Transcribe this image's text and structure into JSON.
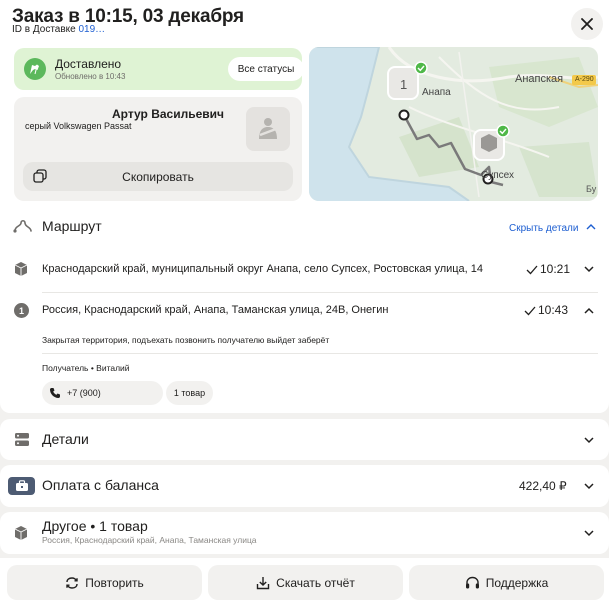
{
  "header": {
    "title": "Заказ в 10:15, 03 декабря",
    "id_prefix": "ID в Доставке ",
    "id_value": "019…"
  },
  "status": {
    "title": "Доставлено",
    "subtitle": "Обновлено в 10:43",
    "all_statuses_label": "Все статусы"
  },
  "driver": {
    "name": "Артур Васильевич",
    "car": "серый Volkswagen Passat",
    "copy_label": "Скопировать"
  },
  "map": {
    "labels": [
      "Анапская",
      "Анапа",
      "Супсех",
      "А-290",
      "Бу"
    ],
    "point_number": "1"
  },
  "route": {
    "title": "Маршрут",
    "hide_details": "Скрыть детали",
    "stops": [
      {
        "address": "Краснодарский край, муниципальный округ Анапа, село Супсех, Ростовская улица, 14",
        "time": "10:21"
      },
      {
        "marker": "1",
        "address": "Россия, Краснодарский край, Анапа, Таманская улица, 24В, Онегин",
        "time": "10:43",
        "comment": "Закрытая территория, подъехать позвонить получателю выйдет заберёт",
        "recipient": "Получатель • Виталий",
        "phone": "+7 (900)",
        "items": "1 товар"
      }
    ]
  },
  "details": {
    "title": "Детали"
  },
  "payment": {
    "title": "Оплата с баланса",
    "amount": "422,40 ₽"
  },
  "other": {
    "title": "Другое • 1 товар",
    "subtitle": "Россия, Краснодарский край, Анапа, Таманская улица"
  },
  "actions": {
    "repeat": "Повторить",
    "download": "Скачать отчёт",
    "support": "Поддержка"
  },
  "colors": {
    "status_bg": "#dff3d4",
    "status_icon": "#5cb85c",
    "link": "#1d5ed1",
    "route_line": "#7a7a7a"
  }
}
